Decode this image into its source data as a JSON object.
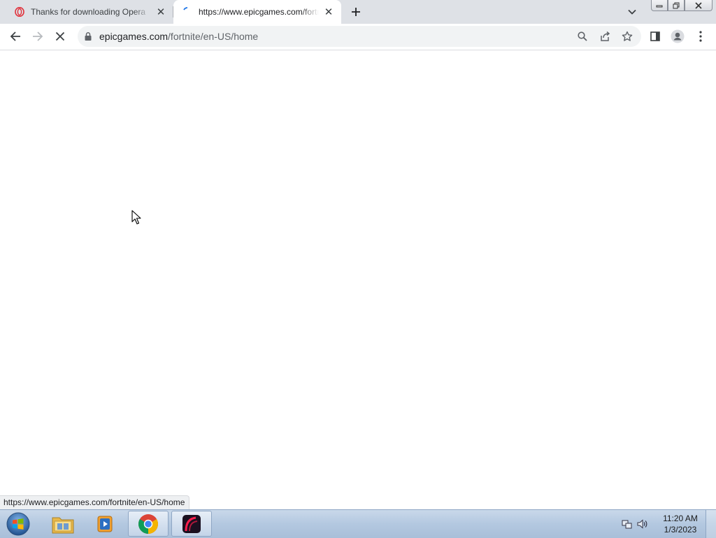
{
  "browser": {
    "tabs": [
      {
        "title": "Thanks for downloading Opera",
        "active": false,
        "favicon": "opera-icon"
      },
      {
        "title": "https://www.epicgames.com/fortnite/en-US/home",
        "active": true,
        "favicon": "loading-icon"
      }
    ],
    "omnibox": {
      "host": "epicgames.com",
      "path": "/fortnite/en-US/home"
    },
    "status_url": "https://www.epicgames.com/fortnite/en-US/home"
  },
  "taskbar": {
    "pinned": [
      {
        "name": "windows-explorer",
        "icon": "folder-icon",
        "open": false
      },
      {
        "name": "windows-media-player",
        "icon": "media-player-icon",
        "open": false
      },
      {
        "name": "google-chrome",
        "icon": "chrome-icon",
        "open": true
      },
      {
        "name": "opera-installer",
        "icon": "opera-gx-icon",
        "open": true
      }
    ],
    "clock": {
      "time": "11:20 AM",
      "date": "1/3/2023"
    }
  },
  "colors": {
    "tabstrip": "#dee1e6",
    "omnibox": "#f1f3f4",
    "taskbar": "#b3c8e0"
  }
}
